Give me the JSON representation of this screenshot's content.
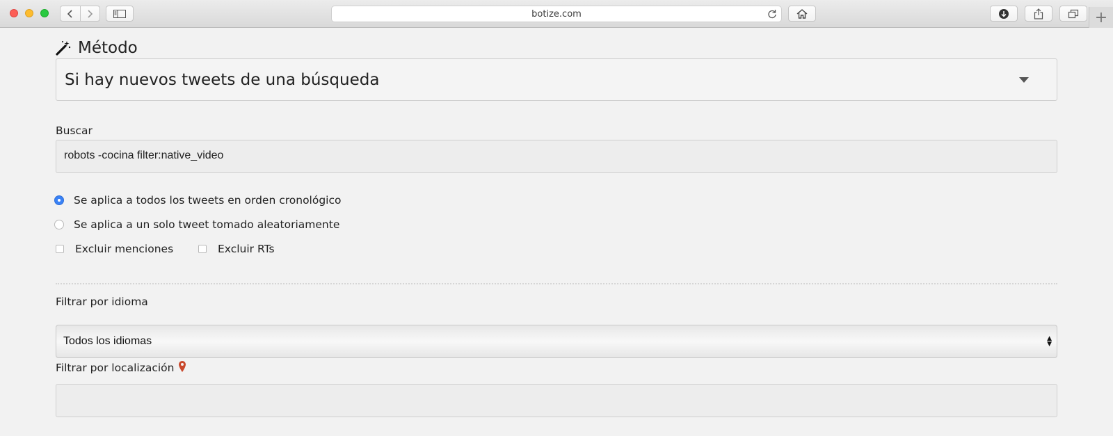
{
  "browser": {
    "url": "botize.com"
  },
  "form": {
    "method": {
      "label": "Método",
      "selected": "Si hay nuevos tweets de una búsqueda"
    },
    "search": {
      "label": "Buscar",
      "value": "robots -cocina filter:native_video"
    },
    "apply_options": [
      {
        "label": "Se aplica a todos los tweets en orden cronológico",
        "checked": true
      },
      {
        "label": "Se aplica a un solo tweet tomado aleatoriamente",
        "checked": false
      }
    ],
    "exclude": {
      "mentions_label": "Excluir menciones",
      "rts_label": "Excluir RTs"
    },
    "language": {
      "label": "Filtrar por idioma",
      "selected": "Todos los idiomas"
    },
    "location": {
      "label": "Filtrar por localización",
      "value": ""
    }
  },
  "colors": {
    "radio_selected": "#3a82f6",
    "location_pin": "#c9482b"
  }
}
